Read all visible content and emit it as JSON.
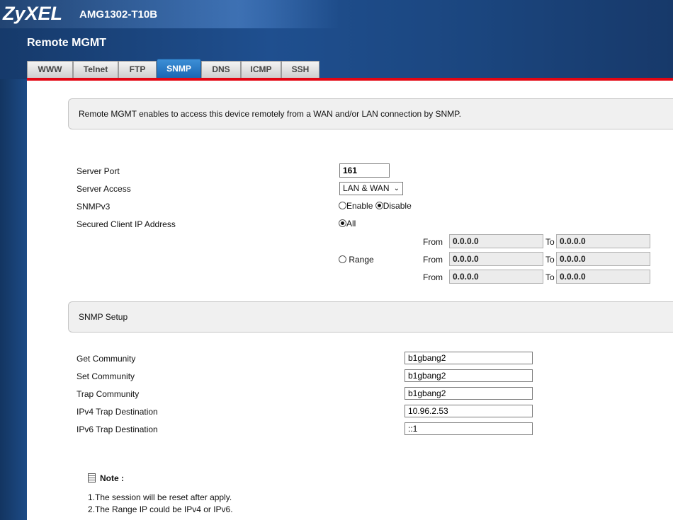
{
  "header": {
    "brand": "ZyXEL",
    "model": "AMG1302-T10B",
    "page_title": "Remote MGMT"
  },
  "tabs": [
    {
      "label": "WWW"
    },
    {
      "label": "Telnet"
    },
    {
      "label": "FTP"
    },
    {
      "label": "SNMP",
      "active": true
    },
    {
      "label": "DNS"
    },
    {
      "label": "ICMP"
    },
    {
      "label": "SSH"
    }
  ],
  "intro": "Remote MGMT enables to access this device remotely from a WAN and/or LAN connection by SNMP.",
  "server": {
    "port_label": "Server Port",
    "port_value": "161",
    "access_label": "Server Access",
    "access_value": "LAN & WAN",
    "snmpv3_label": "SNMPv3",
    "enable_label": "Enable",
    "disable_label": "Disable",
    "snmpv3_selected": "Disable",
    "secured_label": "Secured Client IP Address",
    "all_label": "All",
    "range_label": "Range",
    "secured_selected": "All",
    "from_label": "From",
    "to_label": "To",
    "ranges": [
      {
        "from": "0.0.0.0",
        "to": "0.0.0.0"
      },
      {
        "from": "0.0.0.0",
        "to": "0.0.0.0"
      },
      {
        "from": "0.0.0.0",
        "to": "0.0.0.0"
      }
    ]
  },
  "snmp_setup": {
    "title": "SNMP Setup",
    "get_label": "Get Community",
    "get_value": "b1gbang2",
    "set_label": "Set Community",
    "set_value": "b1gbang2",
    "trap_label": "Trap Community",
    "trap_value": "b1gbang2",
    "ipv4_label": "IPv4 Trap Destination",
    "ipv4_value": "10.96.2.53",
    "ipv6_label": "IPv6 Trap Destination",
    "ipv6_value": "::1"
  },
  "note": {
    "title": "Note :",
    "line1": "1.The session will be reset after apply.",
    "line2": "2.The Range IP could be IPv4 or IPv6."
  },
  "colors": {
    "accent_red": "#e30613",
    "header_blue": "#1f4f8f",
    "tab_active": "#1a67b4"
  }
}
